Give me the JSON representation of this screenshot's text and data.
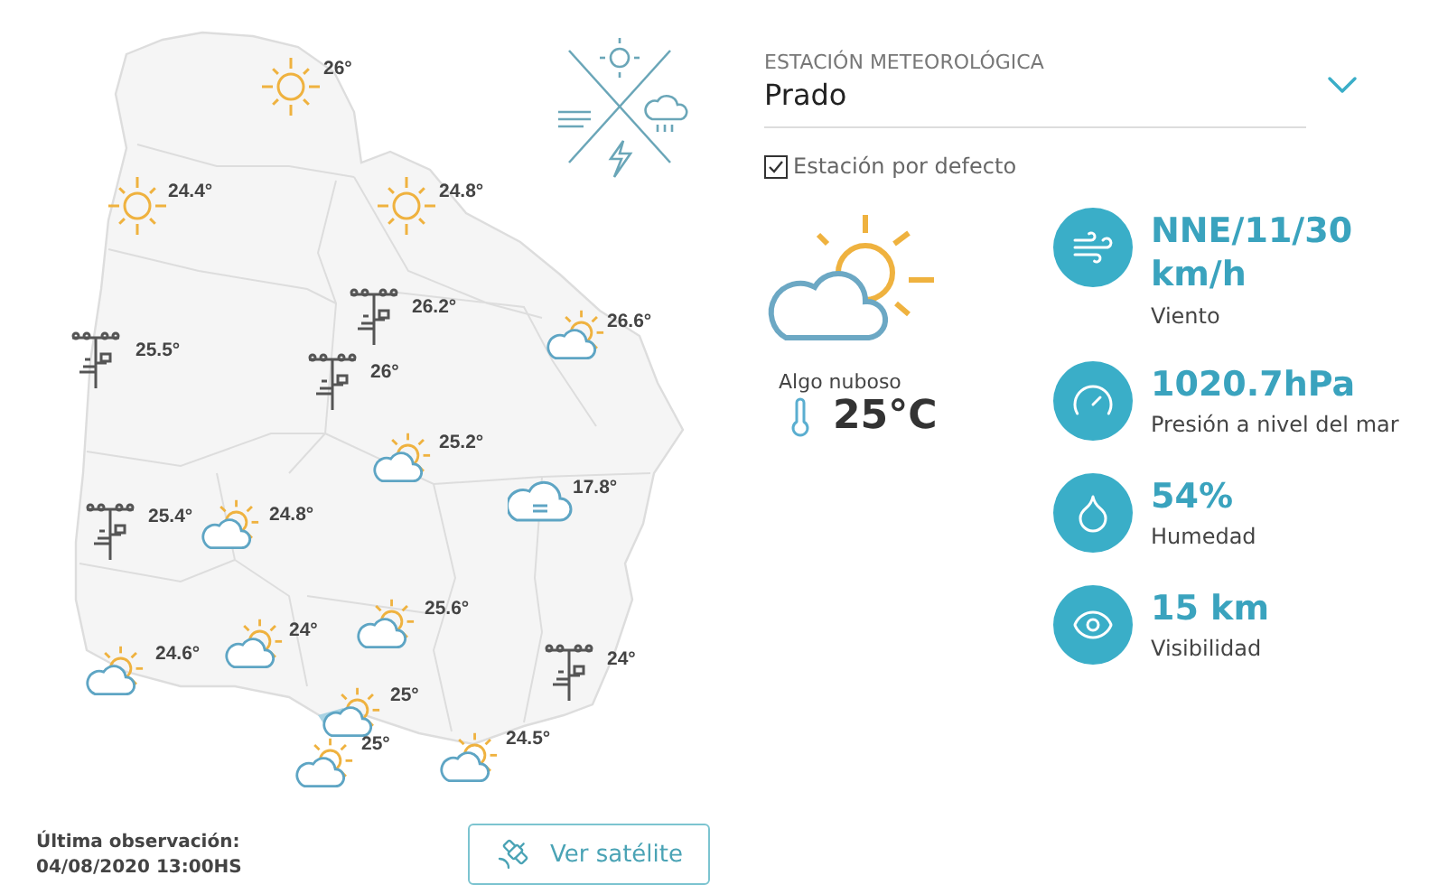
{
  "map": {
    "markers": [
      {
        "kind": "sun",
        "temperature": "26°"
      },
      {
        "kind": "sun",
        "temperature": "24.4°"
      },
      {
        "kind": "sun",
        "temperature": "24.8°"
      },
      {
        "kind": "station",
        "temperature": "26.2°"
      },
      {
        "kind": "station",
        "temperature": "25.5°"
      },
      {
        "kind": "station",
        "temperature": "26°"
      },
      {
        "kind": "partly",
        "temperature": "26.6°"
      },
      {
        "kind": "partly",
        "temperature": "25.2°"
      },
      {
        "kind": "cloudy",
        "temperature": "17.8°"
      },
      {
        "kind": "station",
        "temperature": "25.4°"
      },
      {
        "kind": "partly",
        "temperature": "24.8°"
      },
      {
        "kind": "partly",
        "temperature": "25.6°"
      },
      {
        "kind": "partly",
        "temperature": "24°"
      },
      {
        "kind": "partly",
        "temperature": "24.6°"
      },
      {
        "kind": "station",
        "temperature": "24°"
      },
      {
        "kind": "partly",
        "temperature": "25°"
      },
      {
        "kind": "partly",
        "temperature": "25°"
      },
      {
        "kind": "partly",
        "temperature": "24.5°"
      }
    ]
  },
  "station": {
    "label": "ESTACIÓN METEOROLÓGICA",
    "value": "Prado",
    "default_checkbox": {
      "label": "Estación por defecto",
      "checked": true
    }
  },
  "current": {
    "condition": "Algo nuboso",
    "temperature": "25°C"
  },
  "stats": [
    {
      "kind": "wind",
      "value": "NNE/11/30 km/h",
      "label": "Viento"
    },
    {
      "kind": "pressure",
      "value": "1020.7hPa",
      "label": "Presión a nivel del mar"
    },
    {
      "kind": "humidity",
      "value": "54%",
      "label": "Humedad"
    },
    {
      "kind": "visibility",
      "value": "15 km",
      "label": "Visibilidad"
    }
  ],
  "last_observation": {
    "label": "Última observación:",
    "time": "04/08/2020 13:00HS"
  },
  "satellite_button": {
    "label": "Ver satélite"
  }
}
